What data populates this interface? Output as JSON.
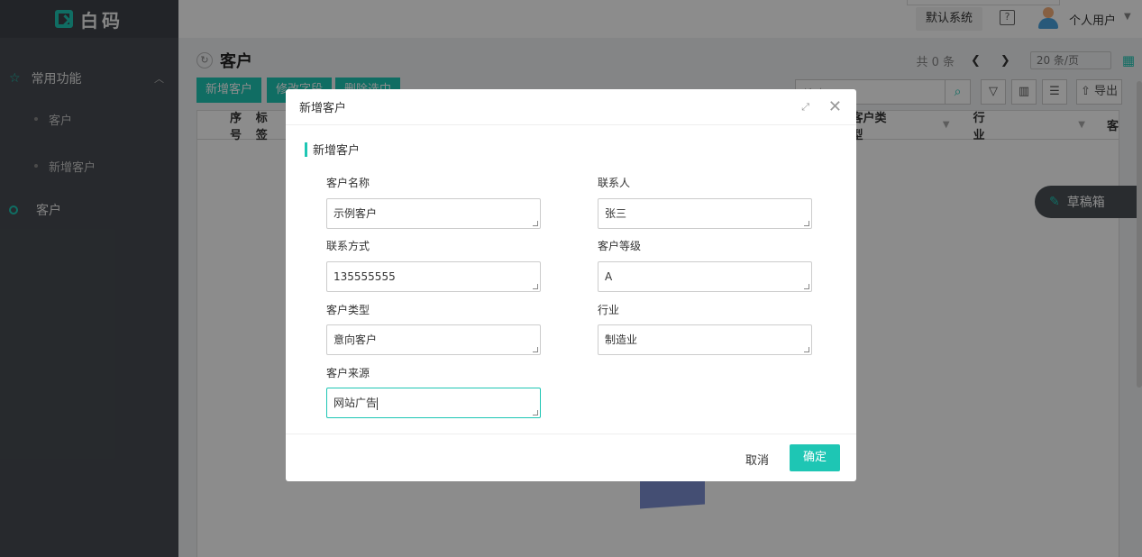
{
  "app": {
    "logo_text": "白码"
  },
  "sidebar": {
    "group_label": "常用功能",
    "sub_items": [
      {
        "label": "客户"
      },
      {
        "label": "新增客户"
      }
    ],
    "item_label": "客户"
  },
  "topbar": {
    "system": "默认系统",
    "help": "?",
    "user": "个人用户"
  },
  "page": {
    "title": "客户",
    "total": "共 0 条",
    "page_size": "20 条/页",
    "buttons": [
      "新增客户",
      "修改字段",
      "删除选中"
    ],
    "search_placeholder": "搜索",
    "export": "导出",
    "columns": [
      "序号",
      "标签",
      "客户类型",
      "行业",
      "客"
    ]
  },
  "draft": {
    "label": "草稿箱"
  },
  "dialog": {
    "title": "新增客户",
    "section": "新增客户",
    "fields": [
      {
        "label": "客户名称",
        "value": "示例客户"
      },
      {
        "label": "联系人",
        "value": "张三"
      },
      {
        "label": "联系方式",
        "value": "135555555"
      },
      {
        "label": "客户等级",
        "value": "A"
      },
      {
        "label": "客户类型",
        "value": "意向客户"
      },
      {
        "label": "行业",
        "value": "制造业"
      },
      {
        "label": "客户来源",
        "value": "网站广告"
      }
    ],
    "cancel": "取消",
    "ok": "确定"
  },
  "colors": {
    "accent": "#1ec6b4",
    "sidebar": "#474c52"
  }
}
